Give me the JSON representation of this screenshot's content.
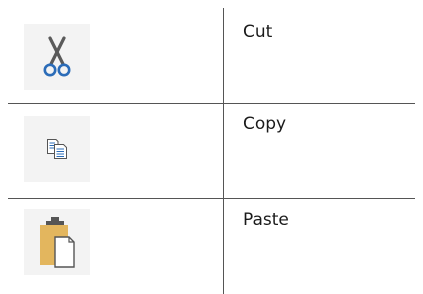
{
  "commands": [
    {
      "label": "Cut",
      "icon": "scissors-icon"
    },
    {
      "label": "Copy",
      "icon": "copy-icon"
    },
    {
      "label": "Paste",
      "icon": "paste-icon"
    }
  ],
  "colors": {
    "icon_background": "#f3f3f3",
    "divider": "#555555",
    "scissors_blade": "#5a5a5a",
    "scissors_handle": "#2b6cb8",
    "copy_lines": "#2b6cb8",
    "clipboard": "#e3b65e"
  }
}
